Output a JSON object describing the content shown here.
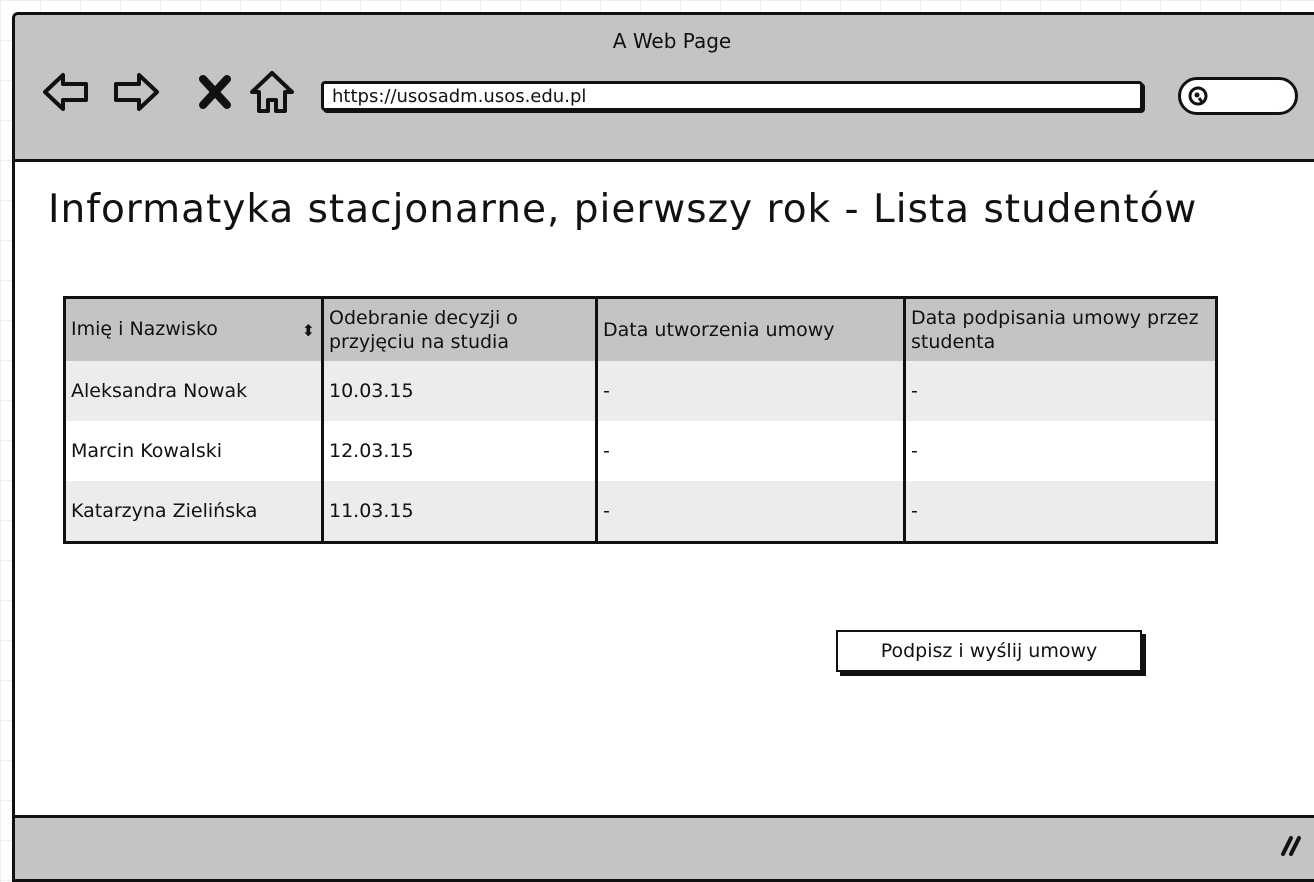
{
  "browser": {
    "title": "A Web Page",
    "url": "https://usosadm.usos.edu.pl",
    "icons": {
      "back": "arrow-left-icon",
      "forward": "arrow-right-icon",
      "stop": "close-icon",
      "home": "home-icon",
      "search": "search-icon",
      "resize": "resize-grip-icon"
    }
  },
  "page": {
    "title": "Informatyka stacjonarne, pierwszy rok - Lista studentów"
  },
  "table": {
    "headers": [
      "Imię i Nazwisko",
      "Odebranie decyzji o przyjęciu na studia",
      "Data utworzenia umowy",
      "Data podpisania umowy przez studenta"
    ],
    "sort_icon": "⬍",
    "rows": [
      [
        "Aleksandra Nowak",
        "10.03.15",
        "-",
        "-"
      ],
      [
        "Marcin Kowalski",
        "12.03.15",
        "-",
        "-"
      ],
      [
        "Katarzyna Zielińska",
        "11.03.15",
        "-",
        "-"
      ]
    ]
  },
  "actions": {
    "sign_send_label": "Podpisz i wyślij umowy"
  },
  "colors": {
    "chrome": "#c4c4c4",
    "border": "#111111",
    "row_alt": "#ececec"
  }
}
